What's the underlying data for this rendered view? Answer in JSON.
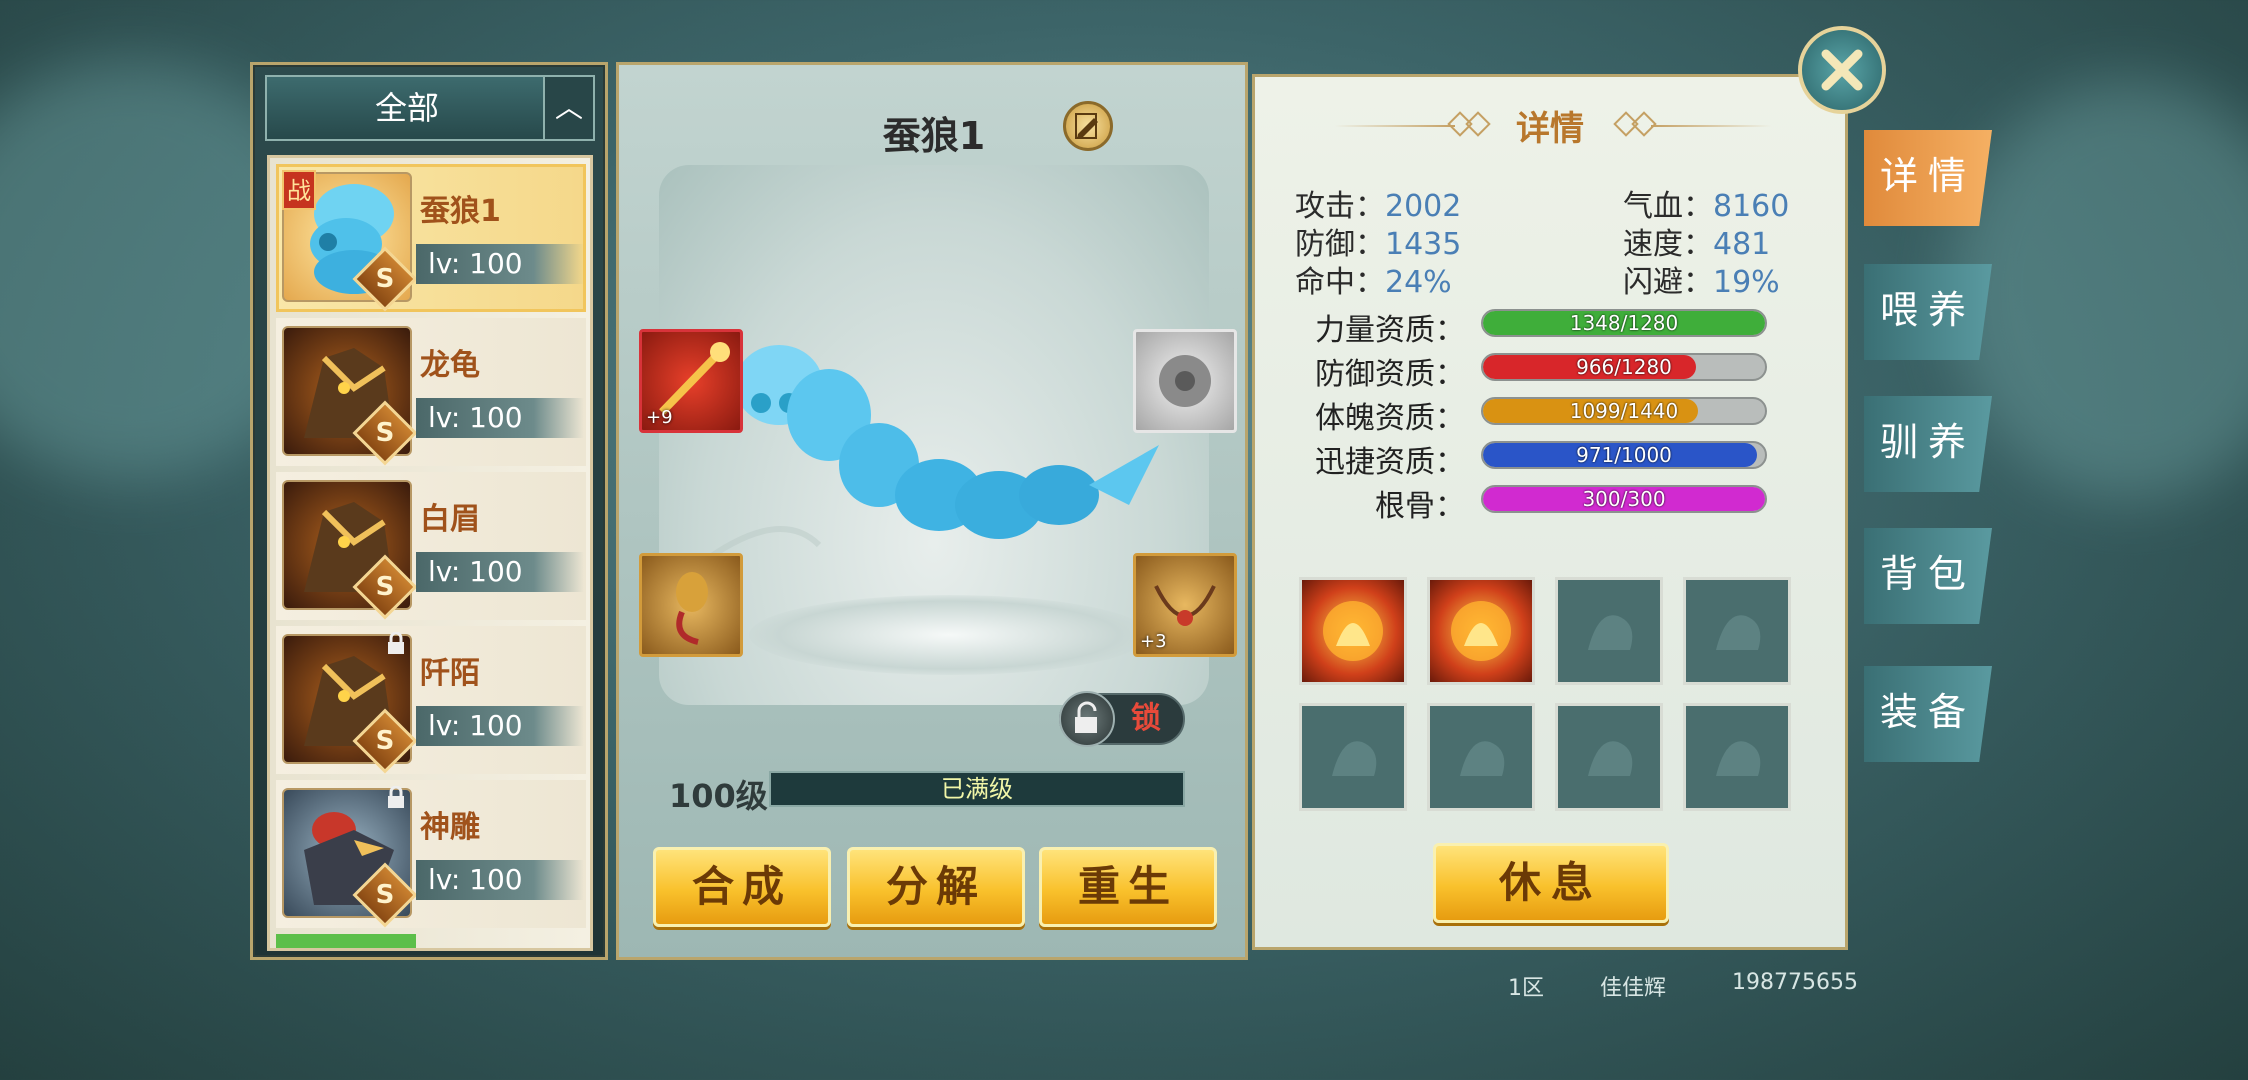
{
  "filter": {
    "label": "全部",
    "toggle_icon": "chevron-up-icon"
  },
  "pets": [
    {
      "name": "蚕狼1",
      "level": "lv: 100",
      "rank": "S",
      "battle_tag": "战",
      "selected": true,
      "locked": false
    },
    {
      "name": "龙龟",
      "level": "lv: 100",
      "rank": "S",
      "selected": false,
      "locked": false
    },
    {
      "name": "白眉",
      "level": "lv: 100",
      "rank": "S",
      "selected": false,
      "locked": false
    },
    {
      "name": "阡陌",
      "level": "lv: 100",
      "rank": "S",
      "selected": false,
      "locked": true
    },
    {
      "name": "神雕",
      "level": "lv: 100",
      "rank": "S",
      "selected": false,
      "locked": true
    }
  ],
  "center": {
    "pet_title": "蚕狼1",
    "equip": [
      {
        "slot": "top-left",
        "plus": "+9"
      },
      {
        "slot": "top-right",
        "plus": ""
      },
      {
        "slot": "bottom-left",
        "plus": ""
      },
      {
        "slot": "bottom-right",
        "plus": "+3"
      }
    ],
    "lock_label": "锁",
    "level_label": "100级",
    "level_status": "已满级",
    "level_progress": 1.0,
    "buttons": {
      "combine": "合成",
      "decompose": "分解",
      "rebirth": "重生"
    }
  },
  "detail": {
    "title": "详情",
    "stats": {
      "attack_label": "攻击：",
      "attack": "2002",
      "hp_label": "气血：",
      "hp": "8160",
      "defense_label": "防御：",
      "defense": "1435",
      "speed_label": "速度：",
      "speed": "481",
      "hit_label": "命中：",
      "hit": "24%",
      "dodge_label": "闪避：",
      "dodge": "19%"
    },
    "aptitudes": [
      {
        "label": "力量资质：",
        "text": "1348/1280",
        "fill": 1.0,
        "color": "#3fae3a"
      },
      {
        "label": "防御资质：",
        "text": "966/1280",
        "fill": 0.755,
        "color": "#d8262a"
      },
      {
        "label": "体魄资质：",
        "text": "1099/1440",
        "fill": 0.763,
        "color": "#d99212"
      },
      {
        "label": "迅捷资质：",
        "text": "971/1000",
        "fill": 0.971,
        "color": "#2a55c8"
      },
      {
        "label": "根骨：",
        "text": "300/300",
        "fill": 1.0,
        "color": "#d12ad0"
      }
    ],
    "skills_filled": [
      true,
      true,
      false,
      false,
      false,
      false,
      false,
      false
    ],
    "rest_button": "休息"
  },
  "tabs": [
    "详情",
    "喂养",
    "驯养",
    "背包",
    "装备"
  ],
  "footer": {
    "server": "1区",
    "player": "佳佳辉",
    "id": "198775655"
  }
}
